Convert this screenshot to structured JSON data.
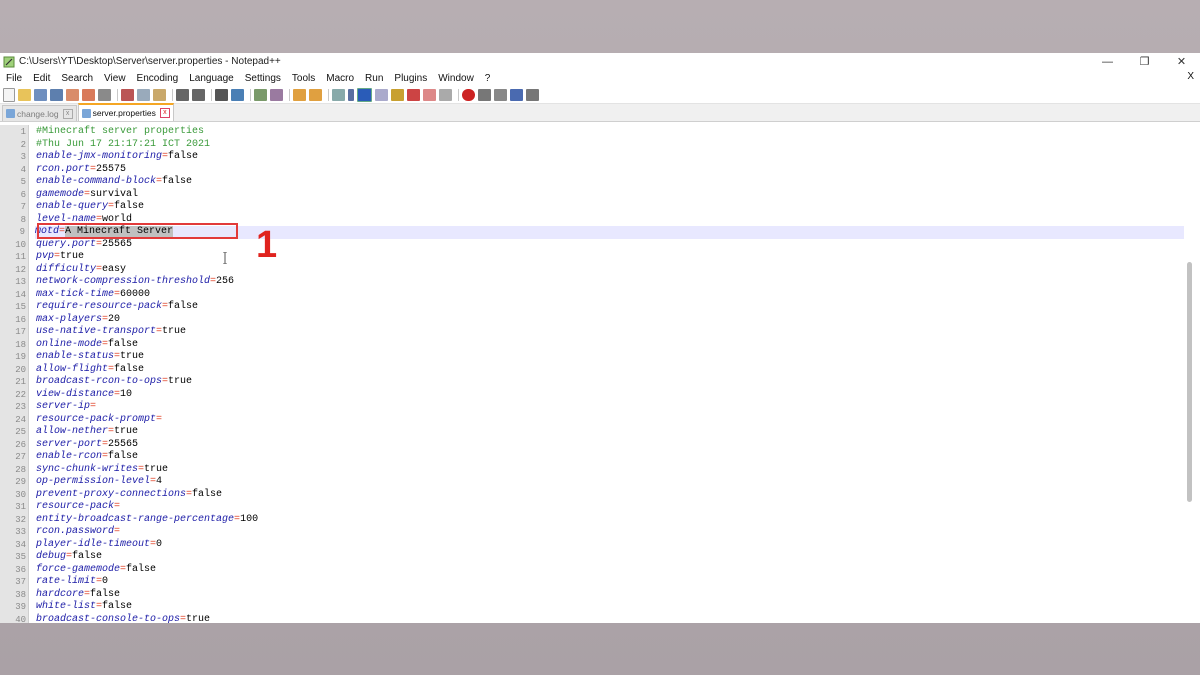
{
  "window": {
    "title": "C:\\Users\\YT\\Desktop\\Server\\server.properties - Notepad++",
    "controls": [
      "—",
      "❐",
      "✕"
    ]
  },
  "menubar": {
    "items": [
      "File",
      "Edit",
      "Search",
      "View",
      "Encoding",
      "Language",
      "Settings",
      "Tools",
      "Macro",
      "Run",
      "Plugins",
      "Window",
      "?"
    ],
    "close": "X"
  },
  "tabs": [
    {
      "label": "change.log",
      "active": false
    },
    {
      "label": "server.properties",
      "active": true
    }
  ],
  "editor": {
    "current_line": 9,
    "lines": [
      {
        "n": "1",
        "comment": "#Minecraft server properties"
      },
      {
        "n": "2",
        "comment": "#Thu Jun 17 21:17:21 ICT 2021"
      },
      {
        "n": "3",
        "key": "enable-jmx-monitoring",
        "value": "false"
      },
      {
        "n": "4",
        "key": "rcon.port",
        "value": "25575"
      },
      {
        "n": "5",
        "key": "enable-command-block",
        "value": "false"
      },
      {
        "n": "6",
        "key": "gamemode",
        "value": "survival"
      },
      {
        "n": "7",
        "key": "enable-query",
        "value": "false"
      },
      {
        "n": "8",
        "key": "level-name",
        "value": "world"
      },
      {
        "n": "9",
        "key": "motd",
        "value": "A Minecraft Server"
      },
      {
        "n": "10",
        "key": "query.port",
        "value": "25565"
      },
      {
        "n": "11",
        "key": "pvp",
        "value": "true"
      },
      {
        "n": "12",
        "key": "difficulty",
        "value": "easy"
      },
      {
        "n": "13",
        "key": "network-compression-threshold",
        "value": "256"
      },
      {
        "n": "14",
        "key": "max-tick-time",
        "value": "60000"
      },
      {
        "n": "15",
        "key": "require-resource-pack",
        "value": "false"
      },
      {
        "n": "16",
        "key": "max-players",
        "value": "20"
      },
      {
        "n": "17",
        "key": "use-native-transport",
        "value": "true"
      },
      {
        "n": "18",
        "key": "online-mode",
        "value": "false"
      },
      {
        "n": "19",
        "key": "enable-status",
        "value": "true"
      },
      {
        "n": "20",
        "key": "allow-flight",
        "value": "false"
      },
      {
        "n": "21",
        "key": "broadcast-rcon-to-ops",
        "value": "true"
      },
      {
        "n": "22",
        "key": "view-distance",
        "value": "10"
      },
      {
        "n": "23",
        "key": "server-ip",
        "value": ""
      },
      {
        "n": "24",
        "key": "resource-pack-prompt",
        "value": ""
      },
      {
        "n": "25",
        "key": "allow-nether",
        "value": "true"
      },
      {
        "n": "26",
        "key": "server-port",
        "value": "25565"
      },
      {
        "n": "27",
        "key": "enable-rcon",
        "value": "false"
      },
      {
        "n": "28",
        "key": "sync-chunk-writes",
        "value": "true"
      },
      {
        "n": "29",
        "key": "op-permission-level",
        "value": "4"
      },
      {
        "n": "30",
        "key": "prevent-proxy-connections",
        "value": "false"
      },
      {
        "n": "31",
        "key": "resource-pack",
        "value": ""
      },
      {
        "n": "32",
        "key": "entity-broadcast-range-percentage",
        "value": "100"
      },
      {
        "n": "33",
        "key": "rcon.password",
        "value": ""
      },
      {
        "n": "34",
        "key": "player-idle-timeout",
        "value": "0"
      },
      {
        "n": "35",
        "key": "debug",
        "value": "false"
      },
      {
        "n": "36",
        "key": "force-gamemode",
        "value": "false"
      },
      {
        "n": "37",
        "key": "rate-limit",
        "value": "0"
      },
      {
        "n": "38",
        "key": "hardcore",
        "value": "false"
      },
      {
        "n": "39",
        "key": "white-list",
        "value": "false"
      },
      {
        "n": "40",
        "key": "broadcast-console-to-ops",
        "value": "true"
      }
    ]
  },
  "annotation": {
    "label": "1",
    "color": "#e0231e"
  }
}
